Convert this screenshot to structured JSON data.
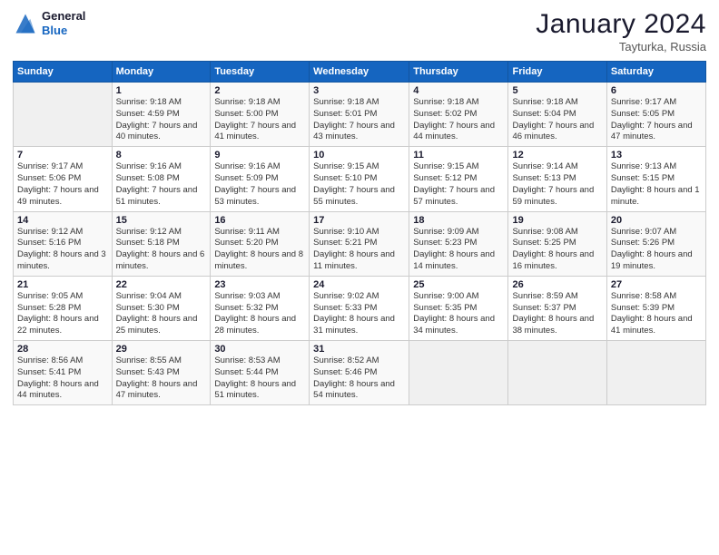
{
  "header": {
    "logo_line1": "General",
    "logo_line2": "Blue",
    "main_title": "January 2024",
    "subtitle": "Tayturka, Russia"
  },
  "calendar": {
    "days": [
      "Sunday",
      "Monday",
      "Tuesday",
      "Wednesday",
      "Thursday",
      "Friday",
      "Saturday"
    ],
    "weeks": [
      [
        {
          "date": "",
          "sunrise": "",
          "sunset": "",
          "daylight": "",
          "empty": true
        },
        {
          "date": "1",
          "sunrise": "Sunrise: 9:18 AM",
          "sunset": "Sunset: 4:59 PM",
          "daylight": "Daylight: 7 hours and 40 minutes."
        },
        {
          "date": "2",
          "sunrise": "Sunrise: 9:18 AM",
          "sunset": "Sunset: 5:00 PM",
          "daylight": "Daylight: 7 hours and 41 minutes."
        },
        {
          "date": "3",
          "sunrise": "Sunrise: 9:18 AM",
          "sunset": "Sunset: 5:01 PM",
          "daylight": "Daylight: 7 hours and 43 minutes."
        },
        {
          "date": "4",
          "sunrise": "Sunrise: 9:18 AM",
          "sunset": "Sunset: 5:02 PM",
          "daylight": "Daylight: 7 hours and 44 minutes."
        },
        {
          "date": "5",
          "sunrise": "Sunrise: 9:18 AM",
          "sunset": "Sunset: 5:04 PM",
          "daylight": "Daylight: 7 hours and 46 minutes."
        },
        {
          "date": "6",
          "sunrise": "Sunrise: 9:17 AM",
          "sunset": "Sunset: 5:05 PM",
          "daylight": "Daylight: 7 hours and 47 minutes."
        }
      ],
      [
        {
          "date": "7",
          "sunrise": "Sunrise: 9:17 AM",
          "sunset": "Sunset: 5:06 PM",
          "daylight": "Daylight: 7 hours and 49 minutes."
        },
        {
          "date": "8",
          "sunrise": "Sunrise: 9:16 AM",
          "sunset": "Sunset: 5:08 PM",
          "daylight": "Daylight: 7 hours and 51 minutes."
        },
        {
          "date": "9",
          "sunrise": "Sunrise: 9:16 AM",
          "sunset": "Sunset: 5:09 PM",
          "daylight": "Daylight: 7 hours and 53 minutes."
        },
        {
          "date": "10",
          "sunrise": "Sunrise: 9:15 AM",
          "sunset": "Sunset: 5:10 PM",
          "daylight": "Daylight: 7 hours and 55 minutes."
        },
        {
          "date": "11",
          "sunrise": "Sunrise: 9:15 AM",
          "sunset": "Sunset: 5:12 PM",
          "daylight": "Daylight: 7 hours and 57 minutes."
        },
        {
          "date": "12",
          "sunrise": "Sunrise: 9:14 AM",
          "sunset": "Sunset: 5:13 PM",
          "daylight": "Daylight: 7 hours and 59 minutes."
        },
        {
          "date": "13",
          "sunrise": "Sunrise: 9:13 AM",
          "sunset": "Sunset: 5:15 PM",
          "daylight": "Daylight: 8 hours and 1 minute."
        }
      ],
      [
        {
          "date": "14",
          "sunrise": "Sunrise: 9:12 AM",
          "sunset": "Sunset: 5:16 PM",
          "daylight": "Daylight: 8 hours and 3 minutes."
        },
        {
          "date": "15",
          "sunrise": "Sunrise: 9:12 AM",
          "sunset": "Sunset: 5:18 PM",
          "daylight": "Daylight: 8 hours and 6 minutes."
        },
        {
          "date": "16",
          "sunrise": "Sunrise: 9:11 AM",
          "sunset": "Sunset: 5:20 PM",
          "daylight": "Daylight: 8 hours and 8 minutes."
        },
        {
          "date": "17",
          "sunrise": "Sunrise: 9:10 AM",
          "sunset": "Sunset: 5:21 PM",
          "daylight": "Daylight: 8 hours and 11 minutes."
        },
        {
          "date": "18",
          "sunrise": "Sunrise: 9:09 AM",
          "sunset": "Sunset: 5:23 PM",
          "daylight": "Daylight: 8 hours and 14 minutes."
        },
        {
          "date": "19",
          "sunrise": "Sunrise: 9:08 AM",
          "sunset": "Sunset: 5:25 PM",
          "daylight": "Daylight: 8 hours and 16 minutes."
        },
        {
          "date": "20",
          "sunrise": "Sunrise: 9:07 AM",
          "sunset": "Sunset: 5:26 PM",
          "daylight": "Daylight: 8 hours and 19 minutes."
        }
      ],
      [
        {
          "date": "21",
          "sunrise": "Sunrise: 9:05 AM",
          "sunset": "Sunset: 5:28 PM",
          "daylight": "Daylight: 8 hours and 22 minutes."
        },
        {
          "date": "22",
          "sunrise": "Sunrise: 9:04 AM",
          "sunset": "Sunset: 5:30 PM",
          "daylight": "Daylight: 8 hours and 25 minutes."
        },
        {
          "date": "23",
          "sunrise": "Sunrise: 9:03 AM",
          "sunset": "Sunset: 5:32 PM",
          "daylight": "Daylight: 8 hours and 28 minutes."
        },
        {
          "date": "24",
          "sunrise": "Sunrise: 9:02 AM",
          "sunset": "Sunset: 5:33 PM",
          "daylight": "Daylight: 8 hours and 31 minutes."
        },
        {
          "date": "25",
          "sunrise": "Sunrise: 9:00 AM",
          "sunset": "Sunset: 5:35 PM",
          "daylight": "Daylight: 8 hours and 34 minutes."
        },
        {
          "date": "26",
          "sunrise": "Sunrise: 8:59 AM",
          "sunset": "Sunset: 5:37 PM",
          "daylight": "Daylight: 8 hours and 38 minutes."
        },
        {
          "date": "27",
          "sunrise": "Sunrise: 8:58 AM",
          "sunset": "Sunset: 5:39 PM",
          "daylight": "Daylight: 8 hours and 41 minutes."
        }
      ],
      [
        {
          "date": "28",
          "sunrise": "Sunrise: 8:56 AM",
          "sunset": "Sunset: 5:41 PM",
          "daylight": "Daylight: 8 hours and 44 minutes."
        },
        {
          "date": "29",
          "sunrise": "Sunrise: 8:55 AM",
          "sunset": "Sunset: 5:43 PM",
          "daylight": "Daylight: 8 hours and 47 minutes."
        },
        {
          "date": "30",
          "sunrise": "Sunrise: 8:53 AM",
          "sunset": "Sunset: 5:44 PM",
          "daylight": "Daylight: 8 hours and 51 minutes."
        },
        {
          "date": "31",
          "sunrise": "Sunrise: 8:52 AM",
          "sunset": "Sunset: 5:46 PM",
          "daylight": "Daylight: 8 hours and 54 minutes."
        },
        {
          "date": "",
          "sunrise": "",
          "sunset": "",
          "daylight": "",
          "empty": true
        },
        {
          "date": "",
          "sunrise": "",
          "sunset": "",
          "daylight": "",
          "empty": true
        },
        {
          "date": "",
          "sunrise": "",
          "sunset": "",
          "daylight": "",
          "empty": true
        }
      ]
    ]
  }
}
